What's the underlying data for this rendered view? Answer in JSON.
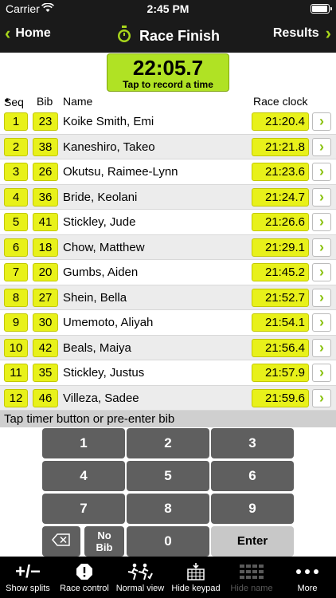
{
  "status": {
    "carrier": "Carrier",
    "time": "2:45 PM"
  },
  "nav": {
    "back_label": "Home",
    "title": "Race Finish",
    "results_label": "Results"
  },
  "timer": {
    "value": "22:05.7",
    "caption": "Tap to record a time"
  },
  "table": {
    "headers": {
      "seq": "Seq",
      "bib": "Bib",
      "name": "Name",
      "clock": "Race clock"
    },
    "rows": [
      {
        "seq": "1",
        "bib": "23",
        "name": "Koike Smith, Emi",
        "clock": "21:20.4"
      },
      {
        "seq": "2",
        "bib": "38",
        "name": "Kaneshiro, Takeo",
        "clock": "21:21.8"
      },
      {
        "seq": "3",
        "bib": "26",
        "name": "Okutsu, Raimee-Lynn",
        "clock": "21:23.6"
      },
      {
        "seq": "4",
        "bib": "36",
        "name": "Bride, Keolani",
        "clock": "21:24.7"
      },
      {
        "seq": "5",
        "bib": "41",
        "name": "Stickley, Jude",
        "clock": "21:26.6"
      },
      {
        "seq": "6",
        "bib": "18",
        "name": "Chow, Matthew",
        "clock": "21:29.1"
      },
      {
        "seq": "7",
        "bib": "20",
        "name": "Gumbs, Aiden",
        "clock": "21:45.2"
      },
      {
        "seq": "8",
        "bib": "27",
        "name": "Shein, Bella",
        "clock": "21:52.7"
      },
      {
        "seq": "9",
        "bib": "30",
        "name": "Umemoto, Aliyah",
        "clock": "21:54.1"
      },
      {
        "seq": "10",
        "bib": "42",
        "name": "Beals, Maiya",
        "clock": "21:56.4"
      },
      {
        "seq": "11",
        "bib": "35",
        "name": "Stickley, Justus",
        "clock": "21:57.9"
      },
      {
        "seq": "12",
        "bib": "46",
        "name": "Villeza, Sadee",
        "clock": "21:59.6"
      }
    ]
  },
  "hint": "Tap timer button or pre-enter bib",
  "keypad": {
    "k1": "1",
    "k2": "2",
    "k3": "3",
    "k4": "4",
    "k5": "5",
    "k6": "6",
    "k7": "7",
    "k8": "8",
    "k9": "9",
    "nobib_line1": "No",
    "nobib_line2": "Bib",
    "k0": "0",
    "enter": "Enter"
  },
  "tabs": {
    "splits": "Show splits",
    "race_control": "Race control",
    "normal_view": "Normal view",
    "hide_keypad": "Hide keypad",
    "hide_name": "Hide name",
    "more": "More"
  },
  "colors": {
    "accent_green": "#b0e224",
    "cell_yellow": "#e8f11a",
    "key_gray": "#5f5f5f"
  }
}
